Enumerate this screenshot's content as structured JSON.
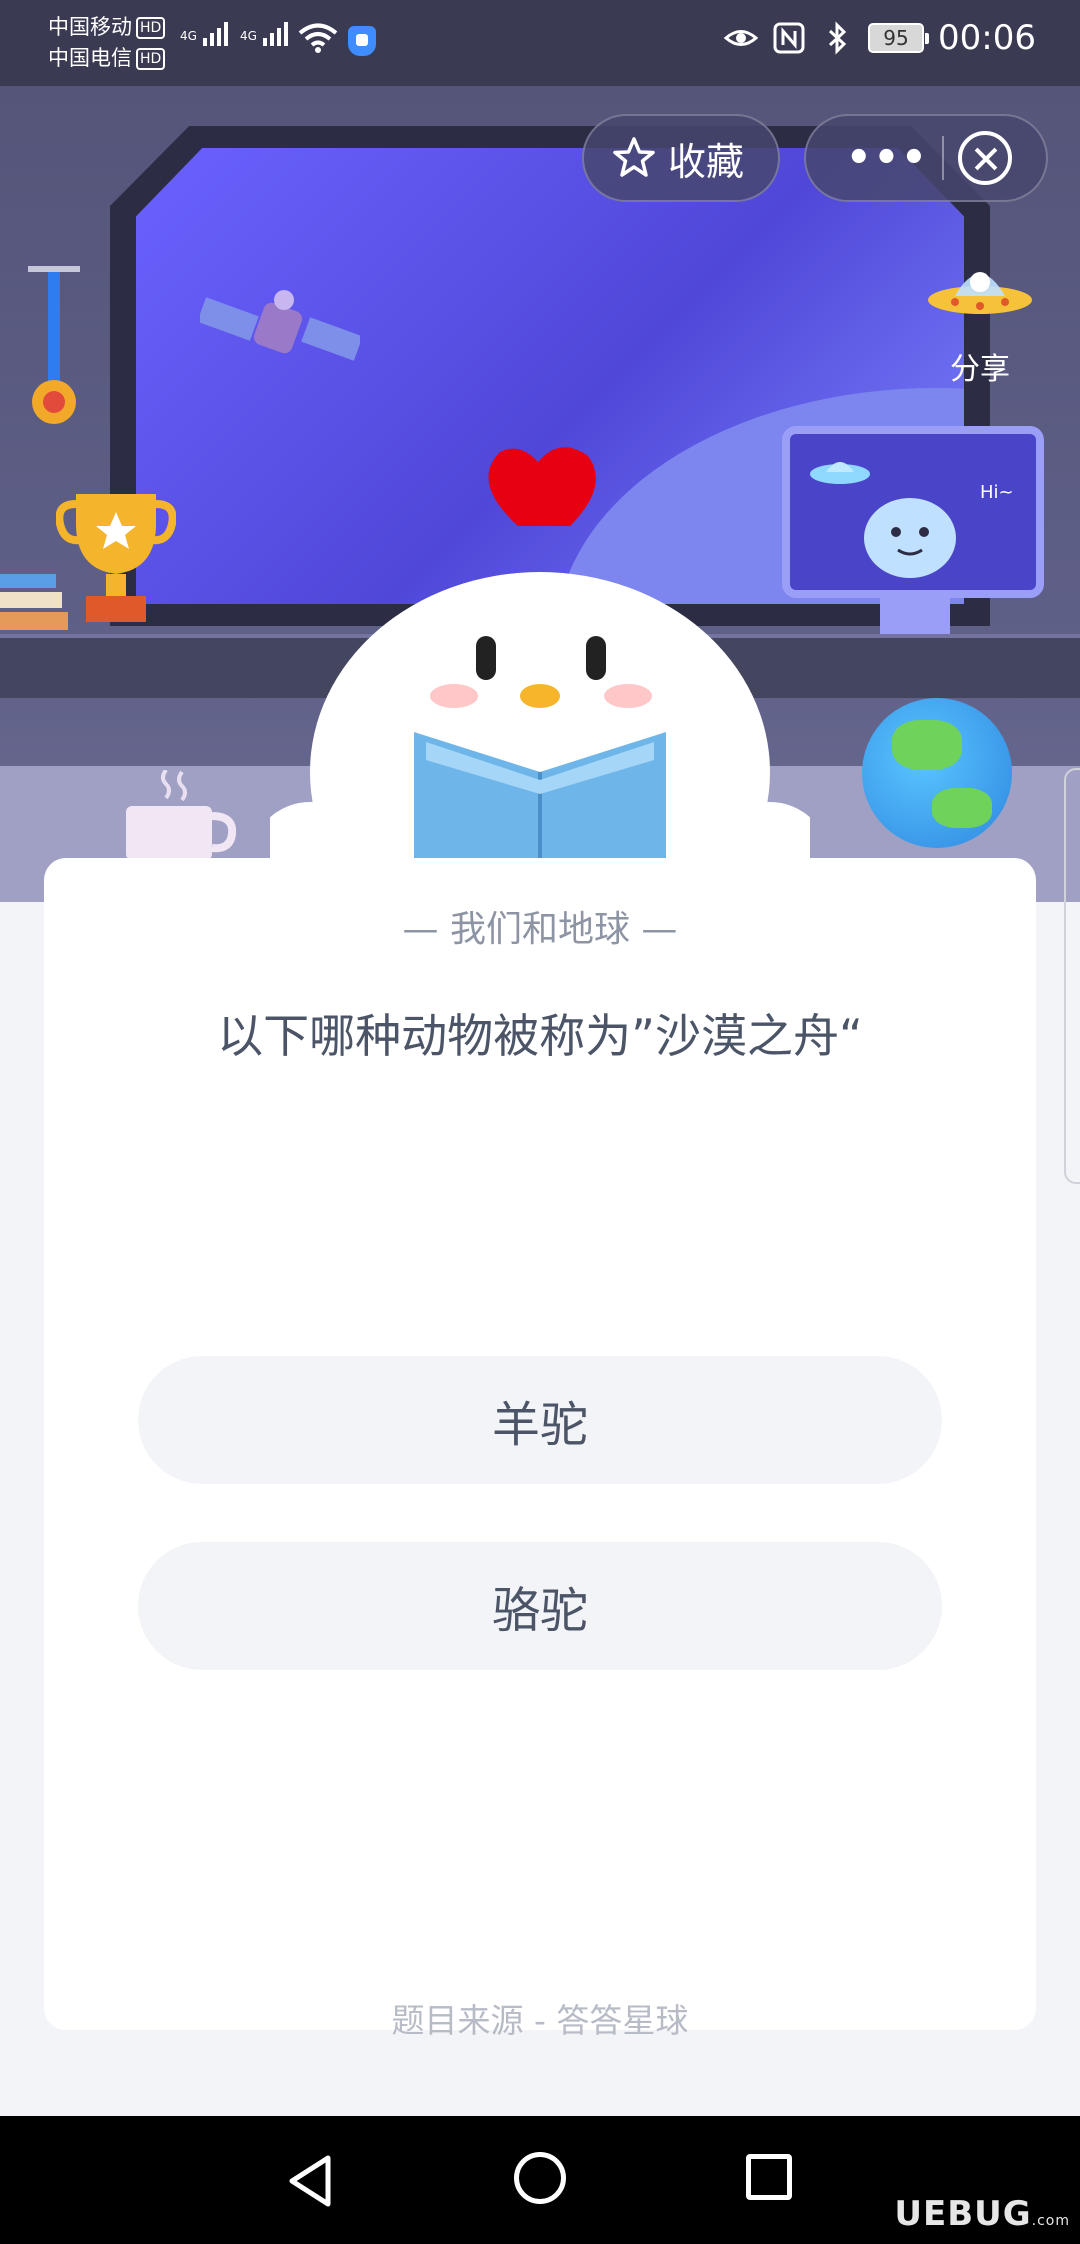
{
  "status_bar": {
    "carrier1": "中国移动",
    "carrier2": "中国电信",
    "hd": "HD",
    "net1": "4G",
    "net2": "4G",
    "battery": "95",
    "time": "00:06"
  },
  "header": {
    "favorite_label": "收藏",
    "more_label": "•••",
    "share_label": "分享"
  },
  "card": {
    "category": "— 我们和地球 —",
    "question": "以下哪种动物被称为”沙漠之舟“",
    "options": [
      "羊驼",
      "骆驼"
    ],
    "source": "题目来源 - 答答星球"
  },
  "watermark": {
    "text": "UEBUG",
    "suffix": ".com"
  },
  "colors": {
    "accent_window": "#5047d8",
    "text_primary": "#4c5567",
    "text_muted": "#8d94a3",
    "option_bg": "#f3f4f7"
  }
}
